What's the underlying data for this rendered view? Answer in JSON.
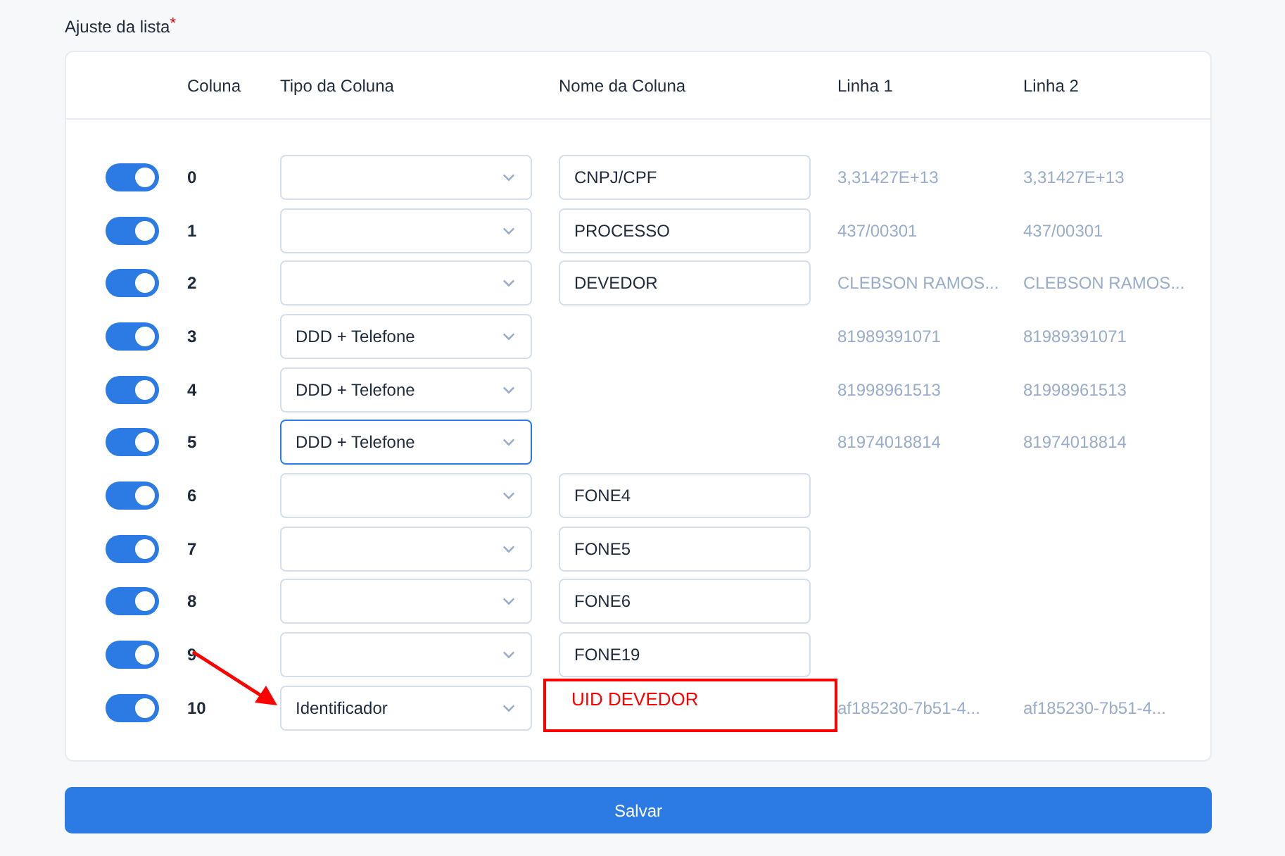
{
  "section_label": "Ajuste da lista",
  "required_mark": "*",
  "table": {
    "columns": [
      "Coluna",
      "Tipo da Coluna",
      "Nome da Coluna",
      "Linha 1",
      "Linha 2"
    ],
    "rows": [
      {
        "on": true,
        "index": "0",
        "focused": false,
        "name": "CNPJ/CPF",
        "line1": "3,31427E+13",
        "line2": "3,31427E+13"
      },
      {
        "on": true,
        "index": "1",
        "focused": false,
        "name": "PROCESSO",
        "line1": "437/00301",
        "line2": "437/00301"
      },
      {
        "on": true,
        "index": "2",
        "focused": false,
        "name": "DEVEDOR",
        "line1": "CLEBSON RAMOS...",
        "line2": "CLEBSON RAMOS..."
      },
      {
        "on": true,
        "index": "3",
        "focused": false,
        "type": "DDD + Telefone",
        "line1": "81989391071",
        "line2": "81989391071"
      },
      {
        "on": true,
        "index": "4",
        "focused": false,
        "type": "DDD + Telefone",
        "line1": "81998961513",
        "line2": "81998961513"
      },
      {
        "on": true,
        "index": "5",
        "focused": true,
        "type": "DDD + Telefone",
        "line1": "81974018814",
        "line2": "81974018814"
      },
      {
        "on": true,
        "index": "6",
        "focused": false,
        "name": "FONE4"
      },
      {
        "on": true,
        "index": "7",
        "focused": false,
        "name": "FONE5"
      },
      {
        "on": true,
        "index": "8",
        "focused": false,
        "name": "FONE6"
      },
      {
        "on": true,
        "index": "9",
        "focused": false,
        "name": "FONE19"
      },
      {
        "on": true,
        "index": "10",
        "focused": false,
        "type": "Identificador",
        "line1": "af185230-7b51-4...",
        "line2": "af185230-7b51-4..."
      }
    ]
  },
  "annotation": {
    "text": "UID DEVEDOR"
  },
  "save_button": "Salvar"
}
